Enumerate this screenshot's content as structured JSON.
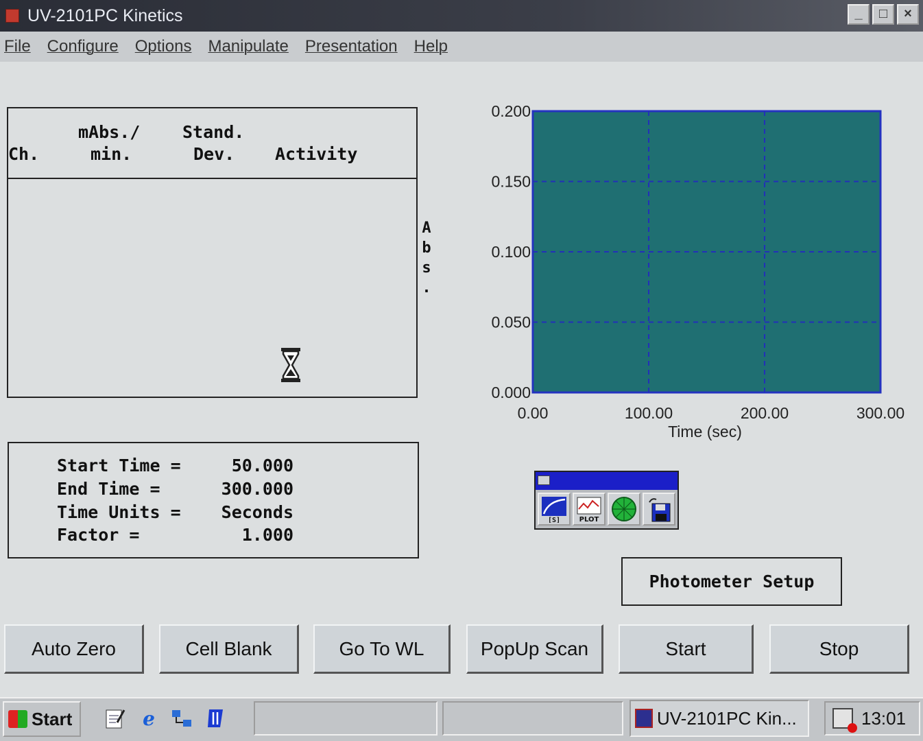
{
  "window": {
    "title": "UV-2101PC Kinetics",
    "controls": [
      "_",
      "□",
      "×"
    ]
  },
  "menu": {
    "items": [
      "File",
      "Configure",
      "Options",
      "Manipulate",
      "Presentation",
      "Help"
    ]
  },
  "results_table": {
    "columns": [
      {
        "line1": "",
        "line2": "Ch."
      },
      {
        "line1": "mAbs./",
        "line2": "min."
      },
      {
        "line1": "Stand.",
        "line2": "Dev."
      },
      {
        "line1": "",
        "line2": "Activity"
      }
    ],
    "rows": [],
    "busy_icon": "hourglass-icon"
  },
  "parameters": {
    "start_time": {
      "label": "Start Time =",
      "value": "50.000"
    },
    "end_time": {
      "label": "End Time =",
      "value": "300.000"
    },
    "time_units": {
      "label": "Time Units =",
      "value": "Seconds"
    },
    "factor": {
      "label": "Factor =",
      "value": "1.000"
    }
  },
  "chart_data": {
    "type": "line",
    "title": "",
    "xlabel": "Time (sec)",
    "ylabel": "Abs.",
    "xlim": [
      0,
      300
    ],
    "ylim": [
      0,
      0.2
    ],
    "x_ticks": [
      "0.00",
      "100.00",
      "200.00",
      "300.00"
    ],
    "y_ticks": [
      "0.000",
      "0.050",
      "0.100",
      "0.150",
      "0.200"
    ],
    "grid": true,
    "series": [],
    "colors": {
      "plot_bg": "#1f6f72",
      "grid": "#2230b8",
      "frame": "#2433c0"
    }
  },
  "toolbox": {
    "tools": [
      "kinetics-curve-icon",
      "plot-icon",
      "green-circle-icon",
      "save-disk-icon"
    ],
    "labels": {
      "curve": "[S]",
      "plot": "PLOT"
    }
  },
  "photometer_button": {
    "label": "Photometer Setup"
  },
  "buttons": [
    "Auto Zero",
    "Cell Blank",
    "Go To WL",
    "PopUp Scan",
    "Start",
    "Stop"
  ],
  "taskbar": {
    "start_label": "Start",
    "quicklaunch": [
      "notepad-icon",
      "internet-explorer-icon",
      "network-icon",
      "app-icon"
    ],
    "task_label": "UV-2101PC Kin...",
    "clock": "13:01"
  }
}
